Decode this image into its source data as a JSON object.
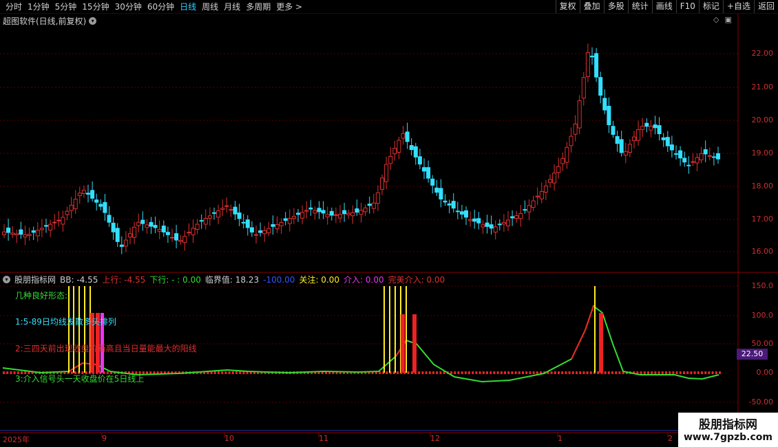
{
  "toolbar": {
    "periods": [
      "分时",
      "1分钟",
      "5分钟",
      "15分钟",
      "30分钟",
      "60分钟",
      "日线",
      "周线",
      "月线",
      "多周期",
      "更多 >"
    ],
    "active_period": "日线",
    "actions": [
      "复权",
      "叠加",
      "多股",
      "统计",
      "画线",
      "F10",
      "标记",
      "+自选",
      "返回"
    ]
  },
  "main_chart": {
    "title": "超图软件(日线,前复权)",
    "y_labels": [
      "22.00",
      "21.00",
      "20.00",
      "19.00",
      "18.00",
      "17.00",
      "16.00"
    ]
  },
  "indicator": {
    "name": "股朋指标网",
    "bb": "BB: -4.55",
    "shang": "上行: -4.55",
    "xia": "下行: - : 0.00",
    "lin": "临界值: 18.23",
    "neg": "-100.00",
    "guan": "关注: 0.00",
    "jie": "介入: 0.00",
    "wan": "完美介入: 0.00",
    "y_labels": [
      "150.0",
      "100.0",
      "50.00",
      "0.00",
      "-50.00"
    ],
    "current_value": "22.50"
  },
  "annotations": {
    "line0": "几种良好形态:",
    "line1": "1:5-89日均线发散多头排列",
    "line2": "2:三四天前出现收盘价新高且当日量能最大的阳线",
    "line3": "3:介入信号头一天收盘价在5日线上"
  },
  "x_axis": {
    "labels": [
      "2025年",
      "9",
      "10",
      "11",
      "12",
      "1",
      "2"
    ]
  },
  "watermark": {
    "title": "股朋指标网",
    "url": "www.7gpzb.com"
  },
  "colors": {
    "up": "#e03030",
    "down": "#33e0ff",
    "green": "#33dd33",
    "yellow": "#ffee22",
    "magenta": "#ee33ee"
  }
}
